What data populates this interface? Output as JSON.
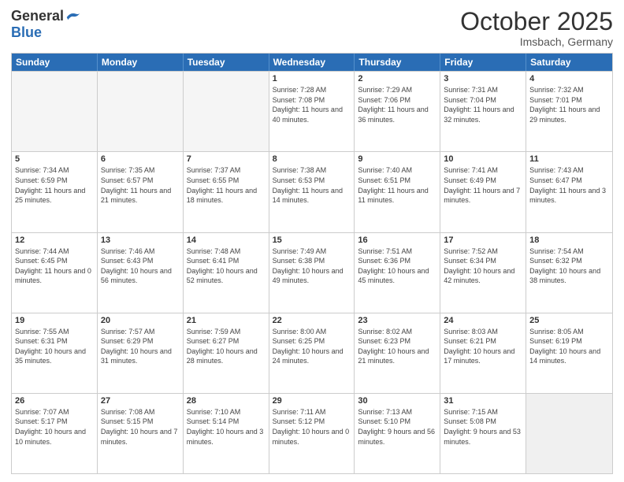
{
  "logo": {
    "general": "General",
    "blue": "Blue"
  },
  "title": "October 2025",
  "location": "Imsbach, Germany",
  "days_of_week": [
    "Sunday",
    "Monday",
    "Tuesday",
    "Wednesday",
    "Thursday",
    "Friday",
    "Saturday"
  ],
  "weeks": [
    [
      {
        "day": "",
        "sunrise": "",
        "sunset": "",
        "daylight": ""
      },
      {
        "day": "",
        "sunrise": "",
        "sunset": "",
        "daylight": ""
      },
      {
        "day": "",
        "sunrise": "",
        "sunset": "",
        "daylight": ""
      },
      {
        "day": "1",
        "sunrise": "Sunrise: 7:28 AM",
        "sunset": "Sunset: 7:08 PM",
        "daylight": "Daylight: 11 hours and 40 minutes."
      },
      {
        "day": "2",
        "sunrise": "Sunrise: 7:29 AM",
        "sunset": "Sunset: 7:06 PM",
        "daylight": "Daylight: 11 hours and 36 minutes."
      },
      {
        "day": "3",
        "sunrise": "Sunrise: 7:31 AM",
        "sunset": "Sunset: 7:04 PM",
        "daylight": "Daylight: 11 hours and 32 minutes."
      },
      {
        "day": "4",
        "sunrise": "Sunrise: 7:32 AM",
        "sunset": "Sunset: 7:01 PM",
        "daylight": "Daylight: 11 hours and 29 minutes."
      }
    ],
    [
      {
        "day": "5",
        "sunrise": "Sunrise: 7:34 AM",
        "sunset": "Sunset: 6:59 PM",
        "daylight": "Daylight: 11 hours and 25 minutes."
      },
      {
        "day": "6",
        "sunrise": "Sunrise: 7:35 AM",
        "sunset": "Sunset: 6:57 PM",
        "daylight": "Daylight: 11 hours and 21 minutes."
      },
      {
        "day": "7",
        "sunrise": "Sunrise: 7:37 AM",
        "sunset": "Sunset: 6:55 PM",
        "daylight": "Daylight: 11 hours and 18 minutes."
      },
      {
        "day": "8",
        "sunrise": "Sunrise: 7:38 AM",
        "sunset": "Sunset: 6:53 PM",
        "daylight": "Daylight: 11 hours and 14 minutes."
      },
      {
        "day": "9",
        "sunrise": "Sunrise: 7:40 AM",
        "sunset": "Sunset: 6:51 PM",
        "daylight": "Daylight: 11 hours and 11 minutes."
      },
      {
        "day": "10",
        "sunrise": "Sunrise: 7:41 AM",
        "sunset": "Sunset: 6:49 PM",
        "daylight": "Daylight: 11 hours and 7 minutes."
      },
      {
        "day": "11",
        "sunrise": "Sunrise: 7:43 AM",
        "sunset": "Sunset: 6:47 PM",
        "daylight": "Daylight: 11 hours and 3 minutes."
      }
    ],
    [
      {
        "day": "12",
        "sunrise": "Sunrise: 7:44 AM",
        "sunset": "Sunset: 6:45 PM",
        "daylight": "Daylight: 11 hours and 0 minutes."
      },
      {
        "day": "13",
        "sunrise": "Sunrise: 7:46 AM",
        "sunset": "Sunset: 6:43 PM",
        "daylight": "Daylight: 10 hours and 56 minutes."
      },
      {
        "day": "14",
        "sunrise": "Sunrise: 7:48 AM",
        "sunset": "Sunset: 6:41 PM",
        "daylight": "Daylight: 10 hours and 52 minutes."
      },
      {
        "day": "15",
        "sunrise": "Sunrise: 7:49 AM",
        "sunset": "Sunset: 6:38 PM",
        "daylight": "Daylight: 10 hours and 49 minutes."
      },
      {
        "day": "16",
        "sunrise": "Sunrise: 7:51 AM",
        "sunset": "Sunset: 6:36 PM",
        "daylight": "Daylight: 10 hours and 45 minutes."
      },
      {
        "day": "17",
        "sunrise": "Sunrise: 7:52 AM",
        "sunset": "Sunset: 6:34 PM",
        "daylight": "Daylight: 10 hours and 42 minutes."
      },
      {
        "day": "18",
        "sunrise": "Sunrise: 7:54 AM",
        "sunset": "Sunset: 6:32 PM",
        "daylight": "Daylight: 10 hours and 38 minutes."
      }
    ],
    [
      {
        "day": "19",
        "sunrise": "Sunrise: 7:55 AM",
        "sunset": "Sunset: 6:31 PM",
        "daylight": "Daylight: 10 hours and 35 minutes."
      },
      {
        "day": "20",
        "sunrise": "Sunrise: 7:57 AM",
        "sunset": "Sunset: 6:29 PM",
        "daylight": "Daylight: 10 hours and 31 minutes."
      },
      {
        "day": "21",
        "sunrise": "Sunrise: 7:59 AM",
        "sunset": "Sunset: 6:27 PM",
        "daylight": "Daylight: 10 hours and 28 minutes."
      },
      {
        "day": "22",
        "sunrise": "Sunrise: 8:00 AM",
        "sunset": "Sunset: 6:25 PM",
        "daylight": "Daylight: 10 hours and 24 minutes."
      },
      {
        "day": "23",
        "sunrise": "Sunrise: 8:02 AM",
        "sunset": "Sunset: 6:23 PM",
        "daylight": "Daylight: 10 hours and 21 minutes."
      },
      {
        "day": "24",
        "sunrise": "Sunrise: 8:03 AM",
        "sunset": "Sunset: 6:21 PM",
        "daylight": "Daylight: 10 hours and 17 minutes."
      },
      {
        "day": "25",
        "sunrise": "Sunrise: 8:05 AM",
        "sunset": "Sunset: 6:19 PM",
        "daylight": "Daylight: 10 hours and 14 minutes."
      }
    ],
    [
      {
        "day": "26",
        "sunrise": "Sunrise: 7:07 AM",
        "sunset": "Sunset: 5:17 PM",
        "daylight": "Daylight: 10 hours and 10 minutes."
      },
      {
        "day": "27",
        "sunrise": "Sunrise: 7:08 AM",
        "sunset": "Sunset: 5:15 PM",
        "daylight": "Daylight: 10 hours and 7 minutes."
      },
      {
        "day": "28",
        "sunrise": "Sunrise: 7:10 AM",
        "sunset": "Sunset: 5:14 PM",
        "daylight": "Daylight: 10 hours and 3 minutes."
      },
      {
        "day": "29",
        "sunrise": "Sunrise: 7:11 AM",
        "sunset": "Sunset: 5:12 PM",
        "daylight": "Daylight: 10 hours and 0 minutes."
      },
      {
        "day": "30",
        "sunrise": "Sunrise: 7:13 AM",
        "sunset": "Sunset: 5:10 PM",
        "daylight": "Daylight: 9 hours and 56 minutes."
      },
      {
        "day": "31",
        "sunrise": "Sunrise: 7:15 AM",
        "sunset": "Sunset: 5:08 PM",
        "daylight": "Daylight: 9 hours and 53 minutes."
      },
      {
        "day": "",
        "sunrise": "",
        "sunset": "",
        "daylight": ""
      }
    ]
  ]
}
